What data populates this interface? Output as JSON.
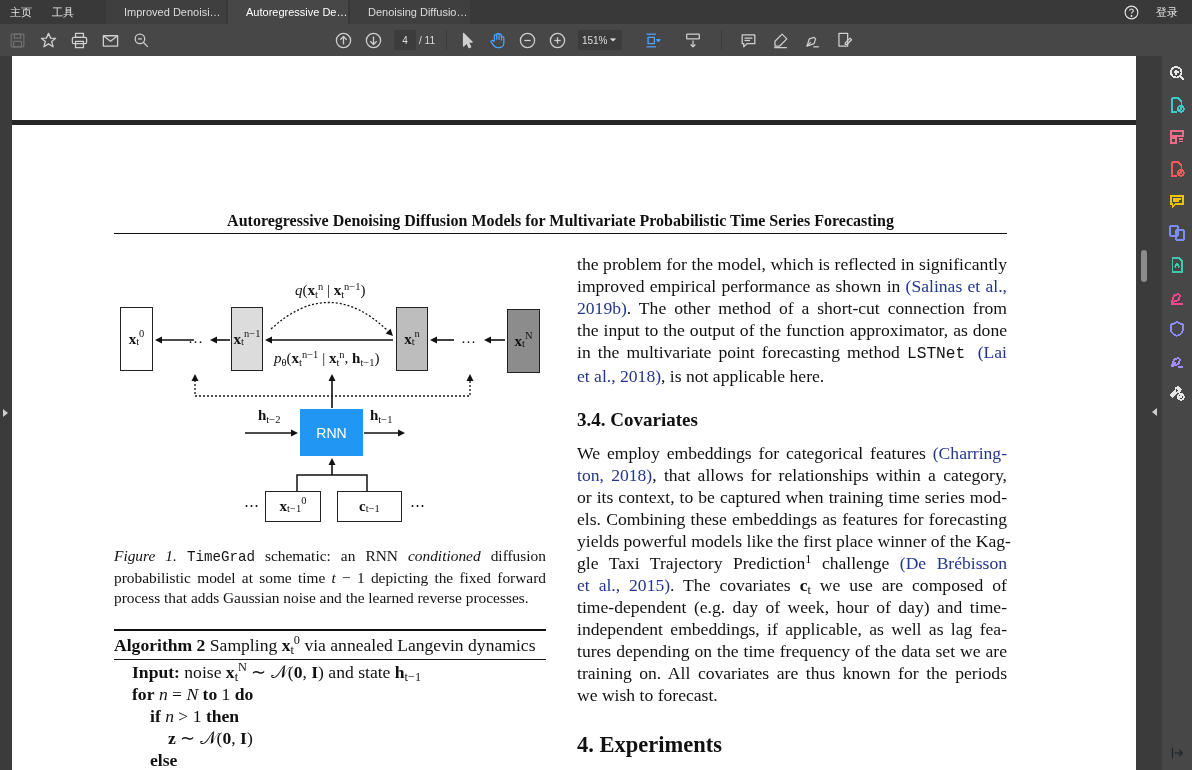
{
  "menu": [
    "主页",
    "工具"
  ],
  "tabs": [
    {
      "label": "Improved Denoisi…",
      "selected": false
    },
    {
      "label": "Autoregressive De…",
      "selected": true
    },
    {
      "label": "Denoising Diffusio…",
      "selected": false
    }
  ],
  "account": "登录",
  "toolbar": {
    "file_tools": [
      {
        "kind": "save",
        "disabled": true
      },
      {
        "kind": "star",
        "disabled": false
      },
      {
        "kind": "print",
        "disabled": false
      },
      {
        "kind": "mail",
        "disabled": false
      },
      {
        "kind": "search",
        "disabled": false
      }
    ],
    "page": {
      "current": "4",
      "total": "/ 11"
    },
    "pointer_tools": [
      {
        "kind": "select",
        "selected": false
      },
      {
        "kind": "hand",
        "selected": true
      }
    ],
    "zoom": "151%",
    "layout_tools": [
      {
        "kind": "fit",
        "selected": true
      },
      {
        "kind": "scroll",
        "selected": false
      }
    ],
    "annotate_tools": [
      {
        "kind": "comment"
      },
      {
        "kind": "highlight"
      },
      {
        "kind": "sign"
      },
      {
        "kind": "fill"
      }
    ]
  },
  "tools_panel": [
    {
      "kind": "zoom",
      "color": "#e6e6e6"
    },
    {
      "kind": "export",
      "color": "#3fc7c7"
    },
    {
      "kind": "organize",
      "color": "#f06b8a"
    },
    {
      "kind": "create",
      "color": "#f05a5a"
    },
    {
      "kind": "comment",
      "color": "#f2c200"
    },
    {
      "kind": "combine",
      "color": "#7b8cff"
    },
    {
      "kind": "edit",
      "color": "#3fc7b0"
    },
    {
      "kind": "fill",
      "color": "#f0458f"
    },
    {
      "kind": "protect",
      "color": "#8a8cff"
    },
    {
      "kind": "sign",
      "color": "#a48cf5"
    },
    {
      "kind": "more",
      "color": "#e6e6e6"
    }
  ],
  "document": {
    "running_header": "Autoregressive Denoising Diffusion Models for Multivariate Probabilistic Time Series Forecasting",
    "figure": {
      "nodes": [
        {
          "kind": "state",
          "label": "**x**$_{t}$$^{0}$",
          "color": "#ffffff"
        },
        {
          "kind": "state",
          "label": "**x**$_{t}$$^{n−1}$",
          "color": "#dcdcdc"
        },
        {
          "kind": "state",
          "label": "**x**$_{t}$$^{n}$",
          "color": "#bdbdbd"
        },
        {
          "kind": "state",
          "label": "**x**$_{t}$$^{N}$",
          "color": "#8c8c8c"
        },
        {
          "kind": "network",
          "label": "RNN",
          "color": "#2196f3"
        },
        {
          "kind": "input",
          "label": "**x**$_{t−1}$$^{0}$",
          "color": "#ffffff"
        },
        {
          "kind": "input",
          "label": "**c**$_{t−1}$",
          "color": "#ffffff"
        }
      ],
      "ellipses": [
        "…",
        "…",
        "⋯",
        "⋯"
      ],
      "edge_labels": [
        "*q*(**x**$_{t}$$^{n}$ | **x**$_{t}$$^{n−1}$)",
        "*p*$_{θ}$(**x**$_{t}$$^{n−1}$ | **x**$_{t}$$^{n}$, **h**$_{t−1}$)",
        "**h**$_{t−2}$",
        "**h**$_{t−1}$"
      ]
    },
    "caption": [
      [
        "*Figure 1.* ",
        {
          "mono": "TimeGrad"
        },
        " schematic: an RNN *conditioned* diffusion"
      ],
      [
        "probabilistic model at some time *t* − 1 depicting the fixed forward"
      ],
      [
        "process that adds Gaussian noise and the learned reverse processes."
      ]
    ],
    "algorithm": {
      "title": "**Algorithm 2** Sampling **x**$_{t}$$^{0}$ via annealed Langevin dynamics",
      "steps": [
        {
          "kind": "statement",
          "text": "**Input:** noise **x**$_{t}$$^{N}$ ∼ 𝒩(**0**, **I**) and state **h**$_{t−1}$"
        },
        {
          "kind": "statement",
          "text": "**for** *n* = *N* **to** 1 **do**",
          "children": [
            {
              "kind": "statement",
              "text": "**if** *n* > 1 **then**",
              "children": [
                {
                  "kind": "statement",
                  "text": "**z** ∼ 𝒩(**0**, **I**)"
                }
              ]
            },
            {
              "kind": "keyword",
              "text": "else"
            }
          ]
        }
      ]
    },
    "body": [
      {
        "kind": "paragraph",
        "lines": [
          [
            "the problem for the model, which is reflected in significantly"
          ],
          [
            "improved empirical performance as shown in ",
            {
              "link": "(Salinas et al.,"
            }
          ],
          [
            {
              "link": "2019b)"
            },
            ". The other method of a short-cut connection from"
          ],
          [
            "the input to the output of the function approximator, as done"
          ],
          [
            "in the multivariate point forecasting method ",
            {
              "mono": "LSTNet "
            },
            {
              "link": "(Lai"
            }
          ],
          [
            {
              "link": "et al., 2018)"
            },
            ", is not applicable here."
          ]
        ]
      },
      {
        "kind": "subsection",
        "text": "3.4. Covariates"
      },
      {
        "kind": "paragraph",
        "lines": [
          [
            "We employ embeddings for categorical features ",
            {
              "link": "(Charring-"
            }
          ],
          [
            {
              "link": "ton, 2018)"
            },
            ", that allows for relationships within a category,"
          ],
          [
            "or its context, to be captured when training time series mod-"
          ],
          [
            "els. Combining these embeddings as features for forecasting"
          ],
          [
            "yields powerful models like the first place winner of the Kag-"
          ],
          [
            "gle Taxi Trajectory Prediction$^{1}$ challenge ",
            {
              "link": "(De Brébisson"
            }
          ],
          [
            {
              "link": "et al., 2015)"
            },
            ". The covariates **c**$_{t}$ we use are composed of"
          ],
          [
            "time-dependent (e.g. day of week, hour of day) and time-"
          ],
          [
            "independent embeddings, if applicable, as well as lag fea-"
          ],
          [
            "tures depending on the time frequency of the data set we are"
          ],
          [
            "training on. All covariates are thus known for the periods"
          ],
          [
            "we wish to forecast."
          ]
        ]
      },
      {
        "kind": "section",
        "text": "4. Experiments"
      }
    ]
  }
}
